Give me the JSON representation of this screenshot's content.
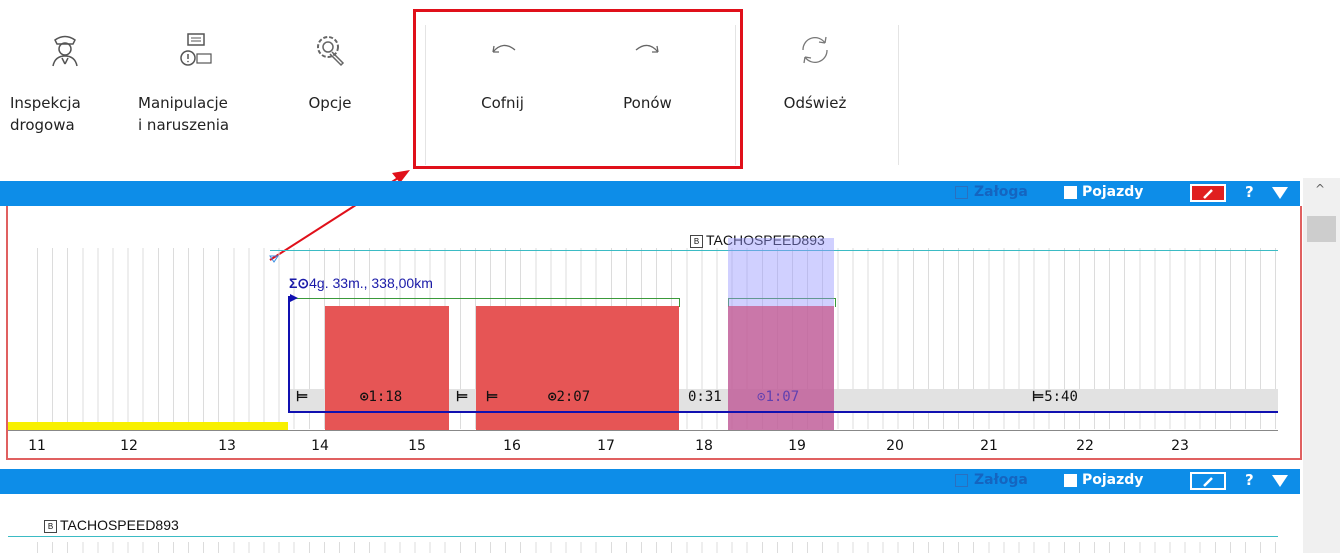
{
  "toolbar": {
    "inspection": "Inspekcja\ndrogowa",
    "manipulation": "Manipulacje\ni naruszenia",
    "options": "Opcje",
    "undo": "Cofnij",
    "redo": "Ponów",
    "refresh": "Odśwież"
  },
  "panel_bar": {
    "crew_label": "Załoga",
    "vehicles_label": "Pojazdy",
    "help": "?"
  },
  "timeline": {
    "vehicle": "TACHOSPEED893",
    "vehicle_badge": "B",
    "summary": "4g. 33m., 338,00km",
    "hours": [
      "11",
      "12",
      "13",
      "14",
      "15",
      "16",
      "17",
      "18",
      "19",
      "20",
      "21",
      "22",
      "23"
    ],
    "segments": {
      "drive1": "1:18",
      "drive2": "2:07",
      "gap": "0:31",
      "drive3": "1:07",
      "rest": "5:40"
    }
  },
  "colors": {
    "header_blue": "#0d8de8",
    "drive_red": "#e65555",
    "highlight_red": "#e0101a",
    "route_blue": "#1010b0"
  },
  "icons": [
    "police-officer-icon",
    "card-warning-icon",
    "gear-wrench-icon",
    "undo-arrow-icon",
    "redo-arrow-icon",
    "refresh-icon",
    "bed-icon",
    "clock-icon",
    "sum-icon"
  ]
}
